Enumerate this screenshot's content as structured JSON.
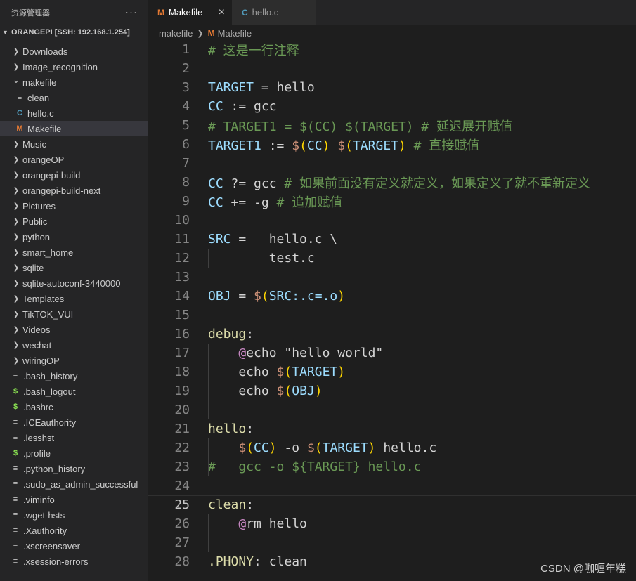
{
  "sidebar": {
    "header": "资源管理器",
    "more": "···",
    "section": "ORANGEPI [SSH: 192.168.1.254]",
    "items": [
      {
        "label": "Downloads",
        "type": "folder",
        "depth": 0,
        "icon": "chevron-right"
      },
      {
        "label": "Image_recognition",
        "type": "folder",
        "depth": 0,
        "icon": "chevron-right"
      },
      {
        "label": "makefile",
        "type": "folder-open",
        "depth": 0,
        "icon": "chevron-down"
      },
      {
        "label": "clean",
        "type": "file",
        "depth": 1,
        "icon": "text-file-icon"
      },
      {
        "label": "hello.c",
        "type": "file",
        "depth": 1,
        "icon": "c-file-icon"
      },
      {
        "label": "Makefile",
        "type": "file",
        "depth": 1,
        "icon": "makefile-icon",
        "selected": true
      },
      {
        "label": "Music",
        "type": "folder",
        "depth": 0,
        "icon": "chevron-right"
      },
      {
        "label": "orangeOP",
        "type": "folder",
        "depth": 0,
        "icon": "chevron-right"
      },
      {
        "label": "orangepi-build",
        "type": "folder",
        "depth": 0,
        "icon": "chevron-right"
      },
      {
        "label": "orangepi-build-next",
        "type": "folder",
        "depth": 0,
        "icon": "chevron-right"
      },
      {
        "label": "Pictures",
        "type": "folder",
        "depth": 0,
        "icon": "chevron-right"
      },
      {
        "label": "Public",
        "type": "folder",
        "depth": 0,
        "icon": "chevron-right"
      },
      {
        "label": "python",
        "type": "folder",
        "depth": 0,
        "icon": "chevron-right"
      },
      {
        "label": "smart_home",
        "type": "folder",
        "depth": 0,
        "icon": "chevron-right"
      },
      {
        "label": "sqlite",
        "type": "folder",
        "depth": 0,
        "icon": "chevron-right"
      },
      {
        "label": "sqlite-autoconf-3440000",
        "type": "folder",
        "depth": 0,
        "icon": "chevron-right"
      },
      {
        "label": "Templates",
        "type": "folder",
        "depth": 0,
        "icon": "chevron-right"
      },
      {
        "label": "TikTOK_VUI",
        "type": "folder",
        "depth": 0,
        "icon": "chevron-right"
      },
      {
        "label": "Videos",
        "type": "folder",
        "depth": 0,
        "icon": "chevron-right"
      },
      {
        "label": "wechat",
        "type": "folder",
        "depth": 0,
        "icon": "chevron-right"
      },
      {
        "label": "wiringOP",
        "type": "folder",
        "depth": 0,
        "icon": "chevron-right"
      },
      {
        "label": ".bash_history",
        "type": "file",
        "depth": 0,
        "icon": "text-file-icon"
      },
      {
        "label": ".bash_logout",
        "type": "file",
        "depth": 0,
        "icon": "shell-file-icon"
      },
      {
        "label": ".bashrc",
        "type": "file",
        "depth": 0,
        "icon": "shell-file-icon"
      },
      {
        "label": ".ICEauthority",
        "type": "file",
        "depth": 0,
        "icon": "text-file-icon"
      },
      {
        "label": ".lesshst",
        "type": "file",
        "depth": 0,
        "icon": "text-file-icon"
      },
      {
        "label": ".profile",
        "type": "file",
        "depth": 0,
        "icon": "shell-file-icon"
      },
      {
        "label": ".python_history",
        "type": "file",
        "depth": 0,
        "icon": "text-file-icon"
      },
      {
        "label": ".sudo_as_admin_successful",
        "type": "file",
        "depth": 0,
        "icon": "text-file-icon"
      },
      {
        "label": ".viminfo",
        "type": "file",
        "depth": 0,
        "icon": "text-file-icon"
      },
      {
        "label": ".wget-hsts",
        "type": "file",
        "depth": 0,
        "icon": "text-file-icon"
      },
      {
        "label": ".Xauthority",
        "type": "file",
        "depth": 0,
        "icon": "text-file-icon"
      },
      {
        "label": ".xscreensaver",
        "type": "file",
        "depth": 0,
        "icon": "text-file-icon"
      },
      {
        "label": ".xsession-errors",
        "type": "file",
        "depth": 0,
        "icon": "text-file-icon"
      }
    ]
  },
  "tabs": [
    {
      "label": "Makefile",
      "icon": "M",
      "active": true,
      "close": "×"
    },
    {
      "label": "hello.c",
      "icon": "C",
      "active": false
    }
  ],
  "breadcrumb": {
    "folder": "makefile",
    "file": "Makefile",
    "icon": "M"
  },
  "editor": {
    "current_line": 25,
    "lines": [
      [
        [
          "# 这是一行注释",
          "cmt"
        ]
      ],
      [],
      [
        [
          "TARGET",
          "var"
        ],
        [
          " = hello",
          "txt"
        ]
      ],
      [
        [
          "CC",
          "var"
        ],
        [
          " := gcc",
          "txt"
        ]
      ],
      [
        [
          "# TARGET1 = $(CC) $(TARGET) # 延迟展开赋值",
          "cmt"
        ]
      ],
      [
        [
          "TARGET1",
          "var"
        ],
        [
          " := ",
          "txt"
        ],
        [
          "$",
          "dol"
        ],
        [
          "(",
          "par"
        ],
        [
          "CC",
          "var"
        ],
        [
          ")",
          "par"
        ],
        [
          " ",
          "txt"
        ],
        [
          "$",
          "dol"
        ],
        [
          "(",
          "par"
        ],
        [
          "TARGET",
          "var"
        ],
        [
          ")",
          "par"
        ],
        [
          " # 直接赋值",
          "cmt"
        ]
      ],
      [],
      [
        [
          "CC",
          "var"
        ],
        [
          " ?= gcc",
          "txt"
        ],
        [
          " # 如果前面没有定义就定义，如果定义了就不重新定义",
          "cmt"
        ]
      ],
      [
        [
          "CC",
          "var"
        ],
        [
          " += -g",
          "txt"
        ],
        [
          " # 追加赋值",
          "cmt"
        ]
      ],
      [],
      [
        [
          "SRC",
          "var"
        ],
        [
          " =   hello.c \\",
          "txt"
        ]
      ],
      [
        [
          "        test.c",
          "txt"
        ]
      ],
      [],
      [
        [
          "OBJ",
          "var"
        ],
        [
          " = ",
          "txt"
        ],
        [
          "$",
          "dol"
        ],
        [
          "(",
          "par"
        ],
        [
          "SRC:.c=.o",
          "var"
        ],
        [
          ")",
          "par"
        ]
      ],
      [],
      [
        [
          "debug",
          "tgt"
        ],
        [
          ":",
          "txt"
        ]
      ],
      [
        [
          "    ",
          "txt"
        ],
        [
          "@",
          "at"
        ],
        [
          "echo \"hello world\"",
          "txt"
        ]
      ],
      [
        [
          "    echo ",
          "txt"
        ],
        [
          "$",
          "dol"
        ],
        [
          "(",
          "par"
        ],
        [
          "TARGET",
          "var"
        ],
        [
          ")",
          "par"
        ]
      ],
      [
        [
          "    echo ",
          "txt"
        ],
        [
          "$",
          "dol"
        ],
        [
          "(",
          "par"
        ],
        [
          "OBJ",
          "var"
        ],
        [
          ")",
          "par"
        ]
      ],
      [],
      [
        [
          "hello",
          "tgt"
        ],
        [
          ":",
          "txt"
        ]
      ],
      [
        [
          "    ",
          "txt"
        ],
        [
          "$",
          "dol"
        ],
        [
          "(",
          "par"
        ],
        [
          "CC",
          "var"
        ],
        [
          ")",
          "par"
        ],
        [
          " -o ",
          "txt"
        ],
        [
          "$",
          "dol"
        ],
        [
          "(",
          "par"
        ],
        [
          "TARGET",
          "var"
        ],
        [
          ")",
          "par"
        ],
        [
          " hello.c",
          "txt"
        ]
      ],
      [
        [
          "#   gcc -o ${TARGET} hello.c",
          "cmt"
        ]
      ],
      [],
      [
        [
          "clean",
          "tgt"
        ],
        [
          ":",
          "txt"
        ]
      ],
      [
        [
          "    ",
          "txt"
        ],
        [
          "@",
          "at"
        ],
        [
          "rm hello",
          "txt"
        ]
      ],
      [],
      [
        [
          ".PHONY",
          "tgt"
        ],
        [
          ": clean",
          "txt"
        ]
      ]
    ]
  },
  "watermark": "CSDN @咖喱年糕",
  "colors": {
    "background": "#1e1e1e",
    "sidebar": "#252526",
    "comment": "#6a9955",
    "variable": "#9cdcfe",
    "target": "#dcdcaa",
    "paren": "#ffd700",
    "makefile_icon": "#e37933",
    "c_icon": "#519aba"
  }
}
